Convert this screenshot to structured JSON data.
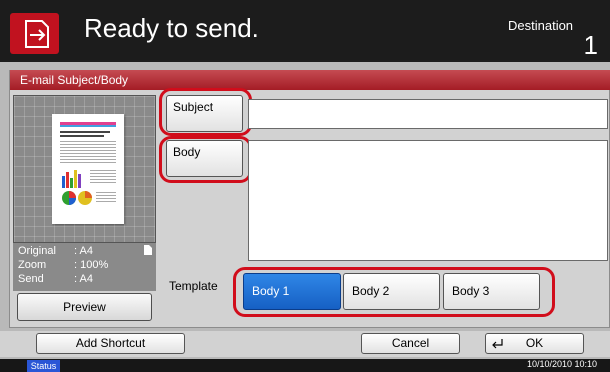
{
  "header": {
    "title": "Ready to send.",
    "destination_label": "Destination",
    "destination_count": "1"
  },
  "panel": {
    "title": "E-mail Subject/Body"
  },
  "fields": {
    "subject_label": "Subject",
    "body_label": "Body",
    "subject_value": "",
    "body_value": ""
  },
  "preview": {
    "original_label": "Original",
    "original_value": ": A4",
    "zoom_label": "Zoom",
    "zoom_value": ": 100%",
    "send_label": "Send",
    "send_value": ": A4",
    "button_label": "Preview"
  },
  "template": {
    "label": "Template",
    "options": [
      "Body 1",
      "Body 2",
      "Body 3"
    ],
    "selected": "Body 1"
  },
  "bottom": {
    "add_shortcut": "Add Shortcut",
    "cancel": "Cancel",
    "ok": "OK"
  },
  "status": {
    "label": "Status",
    "datetime": "10/10/2010  10:10"
  },
  "colors": {
    "accent_red": "#c1121f",
    "highlight_red": "#d10d1b",
    "selected_blue": "#1f73d8"
  }
}
